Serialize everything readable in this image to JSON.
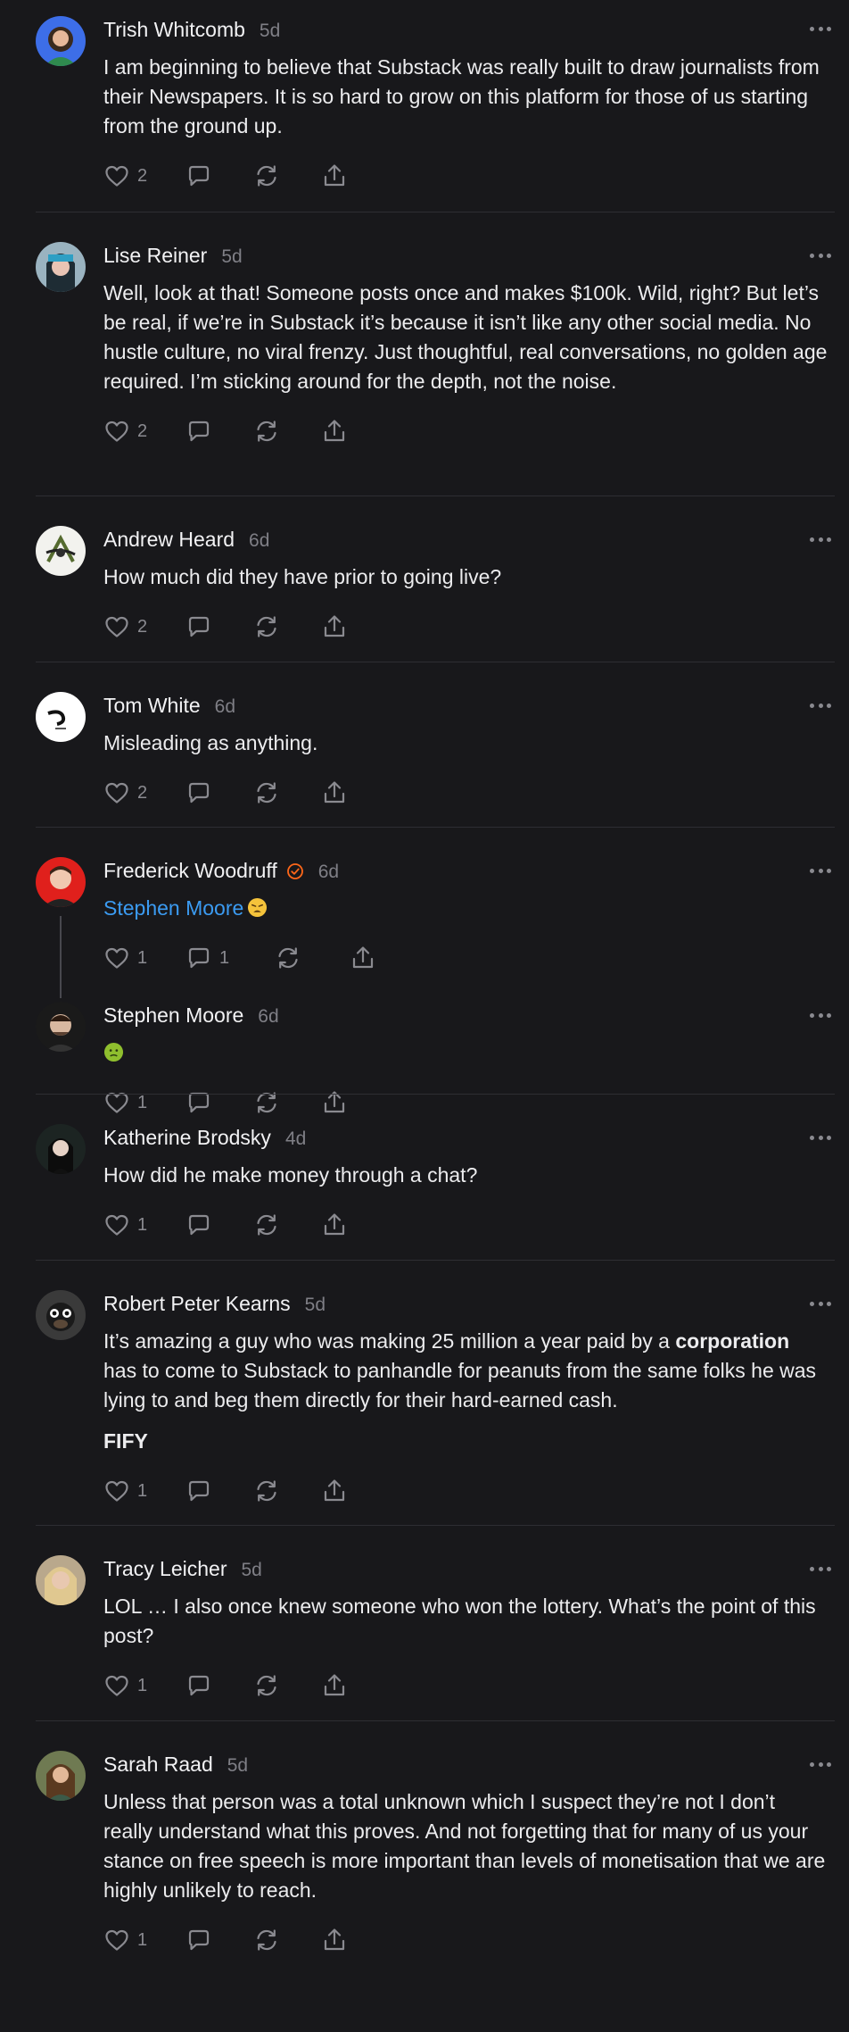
{
  "comments": [
    {
      "name": "Trish Whitcomb",
      "time": "5d",
      "paragraphs": [
        "I am beginning to believe that Substack was really built to draw journalists from their Newspapers. It is so hard to grow on this platform for those of us starting from the ground up."
      ],
      "likes": "2",
      "replies": ""
    },
    {
      "name": "Lise Reiner",
      "time": "5d",
      "paragraphs": [
        "Well, look at that! Someone posts once and makes $100k. Wild, right? But let’s be real, if we’re in Substack it’s because it isn’t like any other social media. No hustle culture, no viral frenzy. Just thoughtful, real conversations, no golden age required. I’m sticking around for the depth, not the noise."
      ],
      "likes": "2",
      "replies": ""
    },
    {
      "name": "Andrew Heard",
      "time": "6d",
      "paragraphs": [
        "How much did they have prior to going live?"
      ],
      "likes": "2",
      "replies": ""
    },
    {
      "name": "Tom White",
      "time": "6d",
      "paragraphs": [
        "Misleading as anything."
      ],
      "likes": "2",
      "replies": ""
    },
    {
      "name": "Frederick Woodruff",
      "time": "6d",
      "mention": "Stephen Moore",
      "likes": "1",
      "replies": "1"
    },
    {
      "name": "Stephen Moore",
      "time": "6d",
      "likes": "1",
      "replies": ""
    },
    {
      "name": "Katherine Brodsky",
      "time": "4d",
      "paragraphs": [
        "How did he make money through a chat?"
      ],
      "likes": "1",
      "replies": ""
    },
    {
      "name": "Robert Peter Kearns",
      "time": "5d",
      "p1_before": "It’s amazing a guy who was making 25 million a year paid by a ",
      "p1_bold": "corporation",
      "p1_after": " has to come to Substack to panhandle for peanuts from the same folks he was lying to and beg them directly for their hard-earned cash.",
      "p2_bold": "FIFY",
      "likes": "1",
      "replies": ""
    },
    {
      "name": "Tracy Leicher",
      "time": "5d",
      "paragraphs": [
        "LOL … I also once knew someone who won the lottery. What’s the point of this post?"
      ],
      "likes": "1",
      "replies": ""
    },
    {
      "name": "Sarah Raad",
      "time": "5d",
      "paragraphs": [
        "Unless that person was a total unknown which I suspect they’re not I don’t really understand what this proves. And not forgetting that for many of us your stance on free speech is more important than levels of monetisation that we are highly unlikely to reach."
      ],
      "likes": "1",
      "replies": ""
    }
  ],
  "colors": {
    "background": "#18181b",
    "mention": "#3b9bf2",
    "badge": "#ff6719",
    "muted": "#8a8a90"
  },
  "icons": {
    "like": "heart-icon",
    "reply": "comment-icon",
    "restack": "restack-icon",
    "share": "share-icon",
    "more": "more-icon"
  }
}
